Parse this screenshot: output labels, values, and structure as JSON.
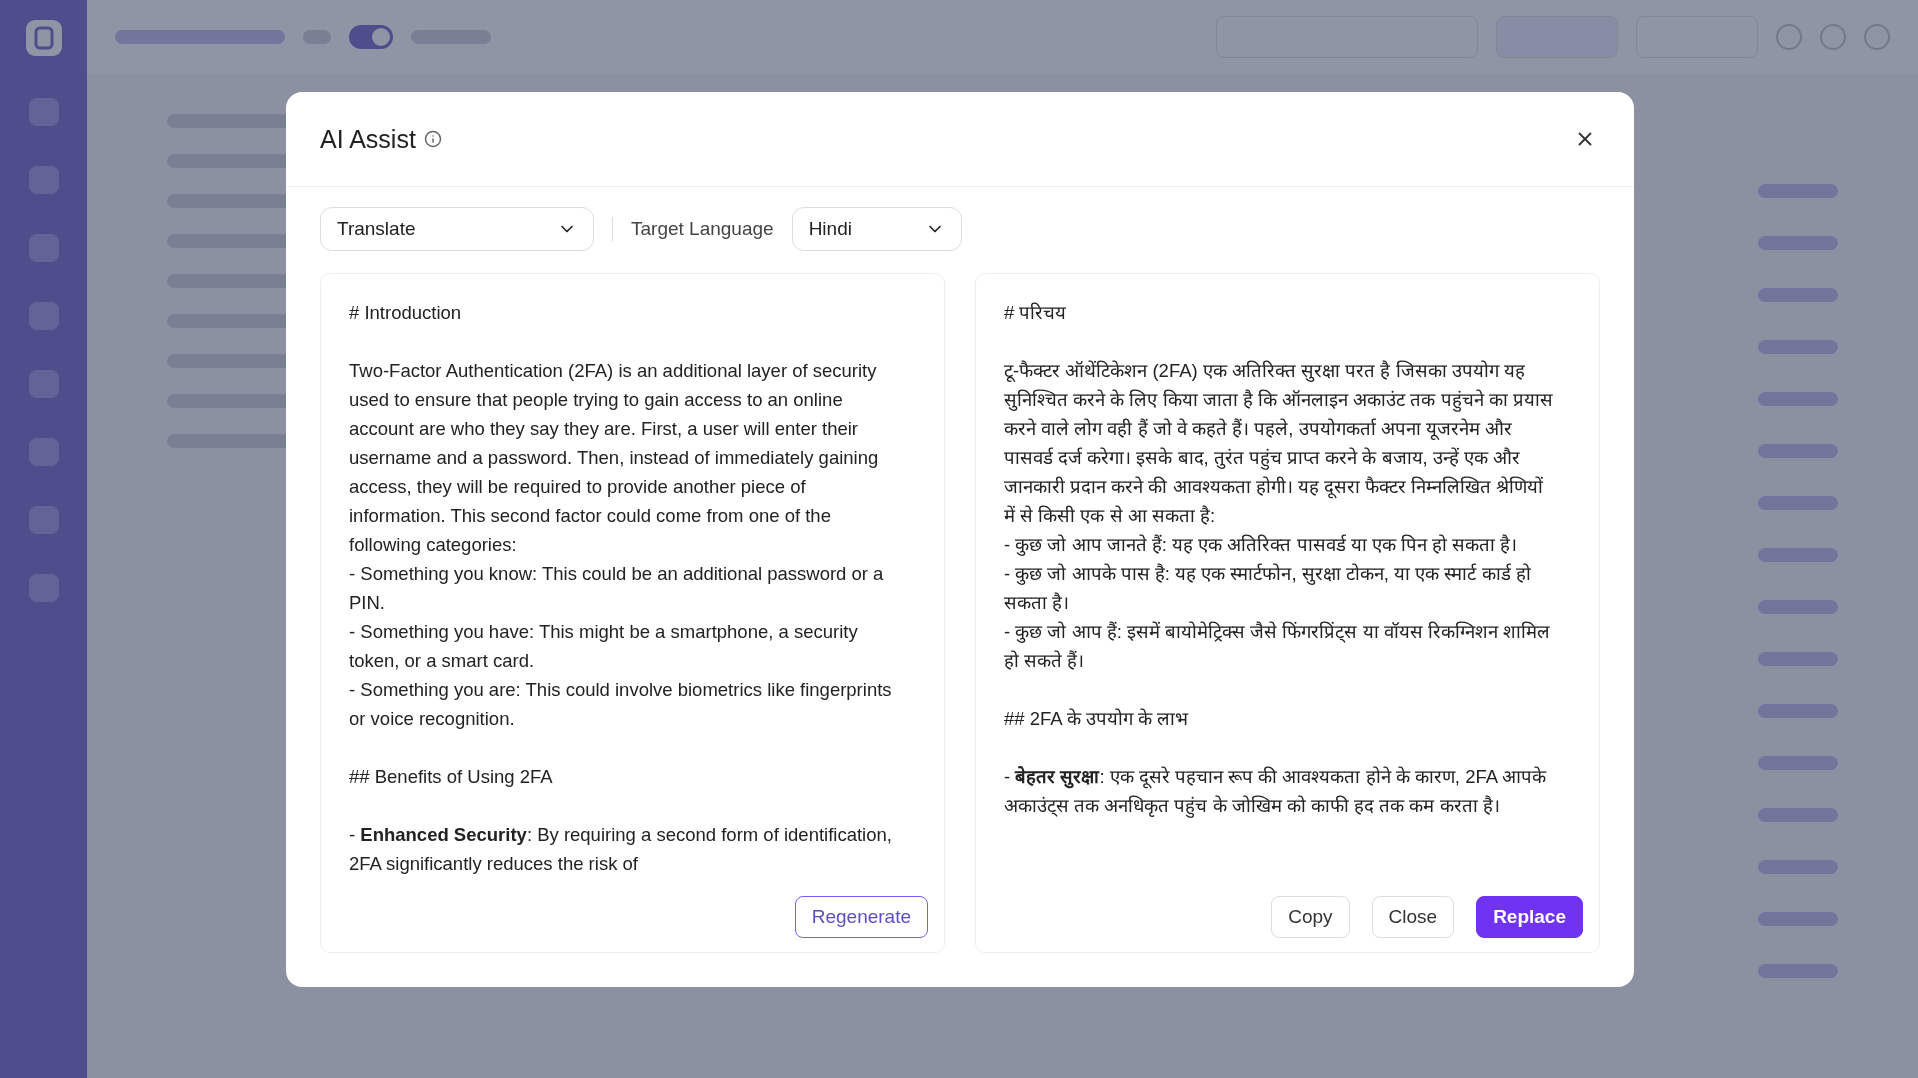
{
  "topbar": {
    "auto_save": {
      "on": true
    }
  },
  "dialog": {
    "title": "AI Assist",
    "action": {
      "value": "Translate"
    },
    "target_label": "Target Language",
    "target_language": {
      "value": "Hindi"
    },
    "source": {
      "blocks": [
        {
          "kind": "heading",
          "text": "# Introduction"
        },
        {
          "kind": "text",
          "text": "Two-Factor Authentication (2FA) is an additional layer of security used to ensure that people trying to gain access to an online account are who they say they are. First, a user will enter their username and a password. Then, instead of immediately gaining access, they will be required to provide another piece of information. This second factor could come from one of the following categories:"
        },
        {
          "kind": "text",
          "text": "- Something you know: This could be an additional password or a PIN."
        },
        {
          "kind": "text",
          "text": "- Something you have: This might be a smartphone, a security token, or a smart card."
        },
        {
          "kind": "text",
          "text": "- Something you are: This could involve biometrics like fingerprints or voice recognition."
        },
        {
          "kind": "heading",
          "text": "## Benefits of Using 2FA"
        },
        {
          "kind": "text",
          "text": "- **Enhanced Security**: By requiring a second form of identification, 2FA significantly reduces the risk of"
        }
      ],
      "buttons": [
        {
          "label": "Regenerate",
          "kind": "outline-accent"
        }
      ]
    },
    "result": {
      "blocks": [
        {
          "kind": "heading",
          "text": "# परिचय"
        },
        {
          "kind": "text",
          "text": "टू-फैक्टर ऑथेंटिकेशन (2FA) एक अतिरिक्त सुरक्षा परत है जिसका उपयोग यह सुनिश्चित करने के लिए किया जाता है कि ऑनलाइन अकाउंट तक पहुंचने का प्रयास करने वाले लोग वही हैं जो वे कहते हैं। पहले, उपयोगकर्ता अपना यूजरनेम और पासवर्ड दर्ज करेगा। इसके बाद, तुरंत पहुंच प्राप्त करने के बजाय, उन्हें एक और जानकारी प्रदान करने की आवश्यकता होगी। यह दूसरा फैक्टर निम्नलिखित श्रेणियों में से किसी एक से आ सकता है:"
        },
        {
          "kind": "text",
          "text": "- कुछ जो आप जानते हैं: यह एक अतिरिक्त पासवर्ड या एक पिन हो सकता है।"
        },
        {
          "kind": "text",
          "text": "- कुछ जो आपके पास है: यह एक स्मार्टफोन, सुरक्षा टोकन, या एक स्मार्ट कार्ड हो सकता है।"
        },
        {
          "kind": "text",
          "text": "- कुछ जो आप हैं: इसमें बायोमेट्रिक्स जैसे फिंगरप्रिंट्स या वॉयस रिकग्निशन शामिल हो सकते हैं।"
        },
        {
          "kind": "heading",
          "text": "## 2FA के उपयोग के लाभ"
        },
        {
          "kind": "text",
          "text": "- **बेहतर सुरक्षा**: एक दूसरे पहचान रूप की आवश्यकता होने के कारण, 2FA आपके अकाउंट्स तक अनधिकृत पहुंच के जोखिम को काफी हद तक कम करता है।"
        }
      ],
      "buttons": [
        {
          "label": "Copy",
          "kind": "outline"
        },
        {
          "label": "Close",
          "kind": "outline"
        },
        {
          "label": "Replace",
          "kind": "primary"
        }
      ]
    }
  }
}
